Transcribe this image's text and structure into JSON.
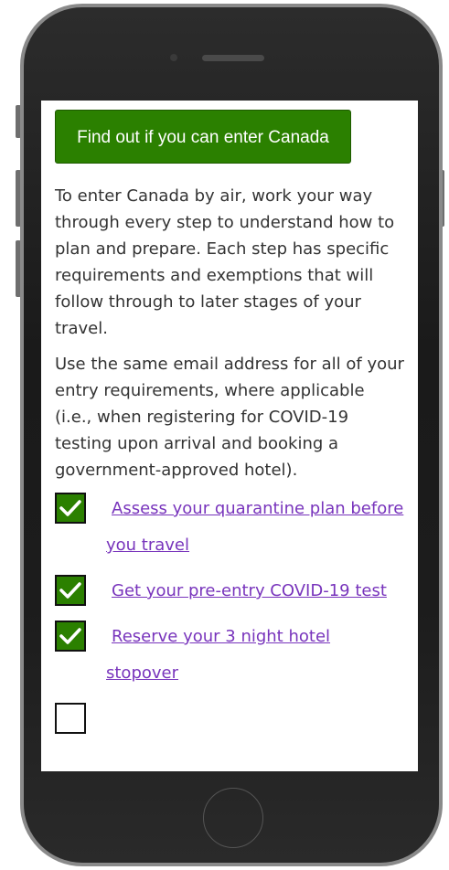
{
  "cta": {
    "label": "Find out if you can enter Canada"
  },
  "intro": {
    "paragraph1": "To enter Canada by air, work your way through every step to understand how to plan and prepare. Each step has specific requirements and exemptions that will follow through to later stages of your travel.",
    "paragraph2": "Use the same email address for all of your entry requirements, where applicable (i.e., when registering for COVID-19 testing upon arrival and booking a government-approved hotel)."
  },
  "checklist": [
    {
      "label": "Assess your quarantine plan before you travel",
      "checked": true
    },
    {
      "label": "Get your pre-entry COVID-19 test",
      "checked": true
    },
    {
      "label": "Reserve your 3 night hotel stopover",
      "checked": true
    },
    {
      "label": "",
      "checked": false
    }
  ],
  "colors": {
    "button_green": "#2b8000",
    "link_purple": "#7834bc",
    "text": "#333333",
    "phone_body": "#1c1c1c"
  },
  "icons": {
    "check": "checkmark-icon"
  }
}
